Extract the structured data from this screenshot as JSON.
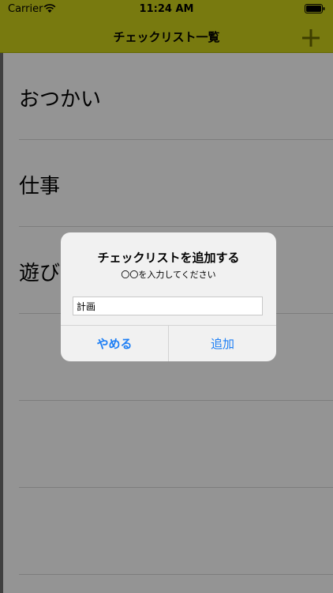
{
  "status": {
    "carrier": "Carrier",
    "time": "11:24 AM"
  },
  "nav": {
    "title": "チェックリスト一覧",
    "add_icon": "plus-icon"
  },
  "list": {
    "items": [
      "おつかい",
      "仕事",
      "遊び",
      "",
      "",
      ""
    ]
  },
  "alert": {
    "title": "チェックリストを追加する",
    "message": "〇〇を入力してください",
    "input_value": "計画",
    "cancel_label": "やめる",
    "add_label": "追加"
  },
  "colors": {
    "nav_bar": "#cfd21a",
    "accent": "#1e7ff5"
  }
}
